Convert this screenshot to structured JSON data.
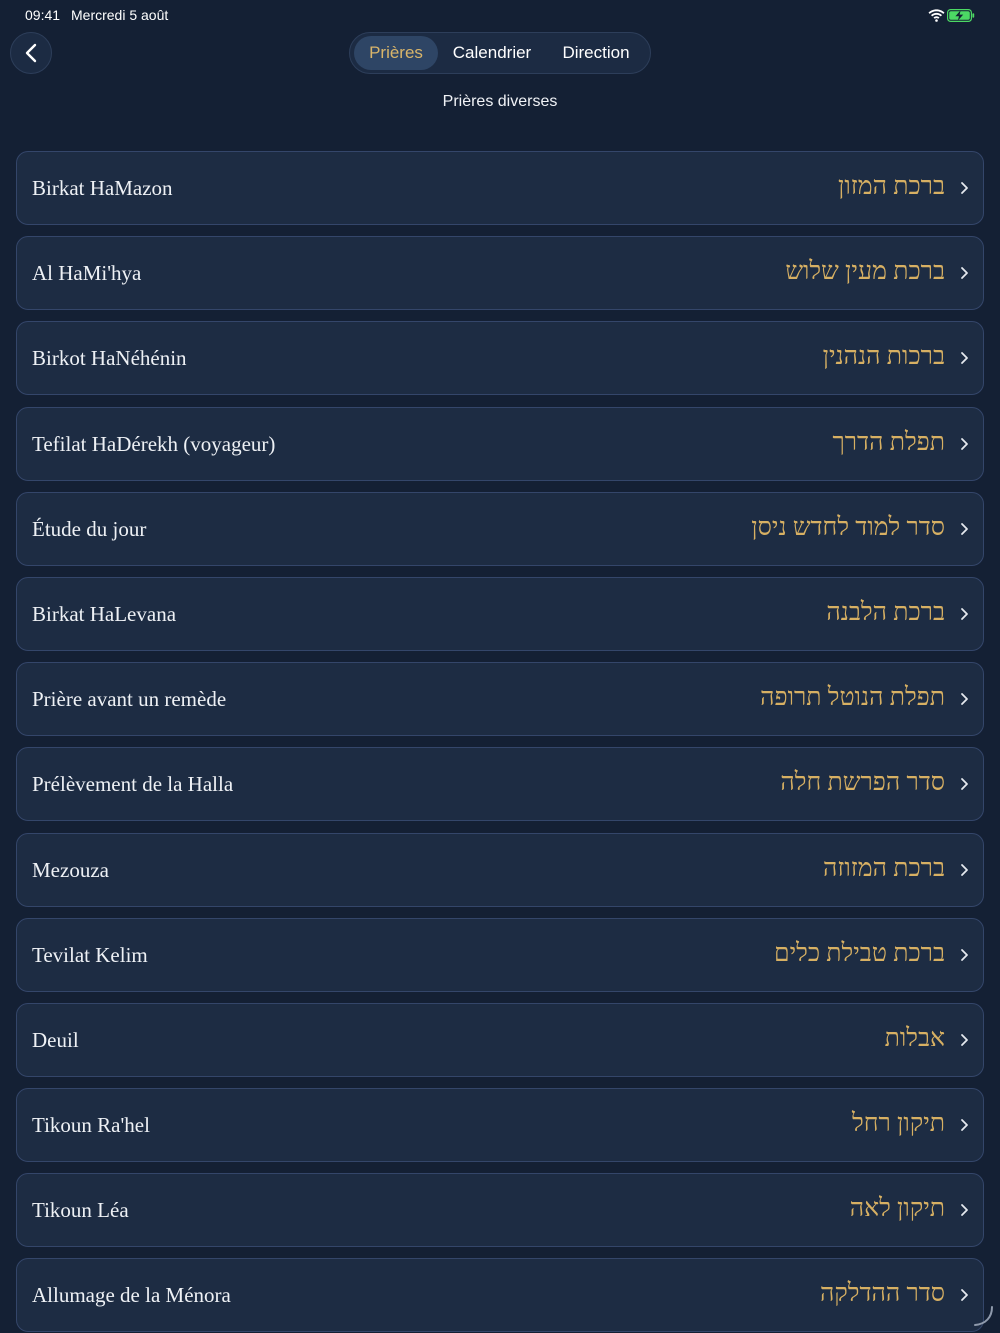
{
  "status_bar": {
    "time": "09:41",
    "date": "Mercredi 5 août",
    "wifi_icon": "wifi-icon",
    "battery_icon": "battery-charging-icon",
    "battery_color": "#4cd964"
  },
  "nav": {
    "back_icon": "chevron-left-icon",
    "tabs": [
      {
        "label": "Prières",
        "active": true
      },
      {
        "label": "Calendrier",
        "active": false
      },
      {
        "label": "Direction",
        "active": false
      }
    ],
    "accent_color": "#d9b56a"
  },
  "section_title": "Prières diverses",
  "items": [
    {
      "fr": "Birkat HaMazon",
      "he": "ברכת המזון"
    },
    {
      "fr": "Al HaMi'hya",
      "he": "ברכת מעין שלוש"
    },
    {
      "fr": "Birkot HaNéhénin",
      "he": "ברכות הנהנין"
    },
    {
      "fr": "Tefilat HaDérekh (voyageur)",
      "he": "תפלת הדרך"
    },
    {
      "fr": "Étude du jour",
      "he": "סדר למוד לחדש ניסן"
    },
    {
      "fr": "Birkat HaLevana",
      "he": "ברכת הלבנה"
    },
    {
      "fr": "Prière avant un remède",
      "he": "תפלת הנוטל תרופה"
    },
    {
      "fr": "Prélèvement de la Halla",
      "he": "סדר הפרשת חלה"
    },
    {
      "fr": "Mezouza",
      "he": "ברכת המזוזה"
    },
    {
      "fr": "Tevilat Kelim",
      "he": "ברכת טבילת כלים"
    },
    {
      "fr": "Deuil",
      "he": "אבלות"
    },
    {
      "fr": "Tikoun Ra'hel",
      "he": "תיקון רחל"
    },
    {
      "fr": "Tikoun Léa",
      "he": "תיקון לאה"
    },
    {
      "fr": "Allumage de la Ménora",
      "he": "סדר ההדלקה"
    }
  ],
  "row_chevron_icon": "chevron-right-icon",
  "hebrew_color": "#d7b063"
}
